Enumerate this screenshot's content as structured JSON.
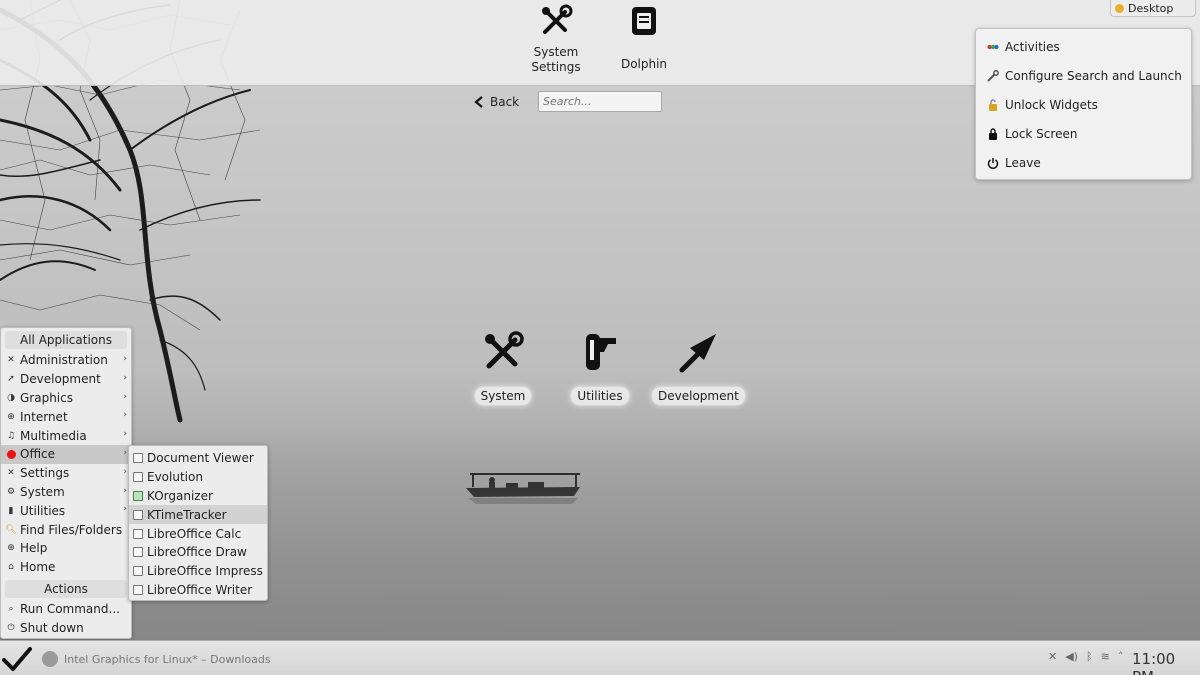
{
  "favorites": [
    {
      "label": "System\nSettings",
      "icon": "tools-icon"
    },
    {
      "label": "Dolphin",
      "icon": "dolphin-icon"
    }
  ],
  "nav": {
    "back_label": "Back",
    "search_placeholder": "Search..."
  },
  "desktop_tab": {
    "label": "Desktop"
  },
  "toolbox": {
    "items": [
      {
        "label": "Activities",
        "icon": "activities-icon"
      },
      {
        "label": "Configure Search and Launch",
        "icon": "wrench-icon"
      },
      {
        "label": "Unlock Widgets",
        "icon": "unlock-icon"
      },
      {
        "label": "Lock Screen",
        "icon": "lock-icon"
      },
      {
        "label": "Leave",
        "icon": "power-icon"
      }
    ]
  },
  "categories": [
    {
      "label": "System",
      "icon": "tools-icon"
    },
    {
      "label": "Utilities",
      "icon": "utilities-icon"
    },
    {
      "label": "Development",
      "icon": "arrow-icon"
    }
  ],
  "app_menu": {
    "header": "All Applications",
    "items": [
      {
        "label": "Administration",
        "has_sub": true
      },
      {
        "label": "Development",
        "has_sub": true
      },
      {
        "label": "Graphics",
        "has_sub": true
      },
      {
        "label": "Internet",
        "has_sub": true
      },
      {
        "label": "Multimedia",
        "has_sub": true
      },
      {
        "label": "Office",
        "has_sub": true,
        "selected": true
      },
      {
        "label": "Settings",
        "has_sub": true
      },
      {
        "label": "System",
        "has_sub": true
      },
      {
        "label": "Utilities",
        "has_sub": true
      },
      {
        "label": "Find Files/Folders"
      },
      {
        "label": "Help"
      },
      {
        "label": "Home"
      }
    ],
    "actions_header": "Actions",
    "actions": [
      {
        "label": "Run Command..."
      },
      {
        "label": "Shut down"
      }
    ]
  },
  "office_submenu": {
    "items": [
      {
        "label": "Document Viewer"
      },
      {
        "label": "Evolution"
      },
      {
        "label": "KOrganizer"
      },
      {
        "label": "KTimeTracker",
        "selected": true
      },
      {
        "label": "LibreOffice Calc"
      },
      {
        "label": "LibreOffice Draw"
      },
      {
        "label": "LibreOffice Impress"
      },
      {
        "label": "LibreOffice Writer"
      }
    ]
  },
  "taskbar": {
    "task_label": "Intel Graphics for Linux* – Downloads",
    "clock": "11:00 PM"
  }
}
